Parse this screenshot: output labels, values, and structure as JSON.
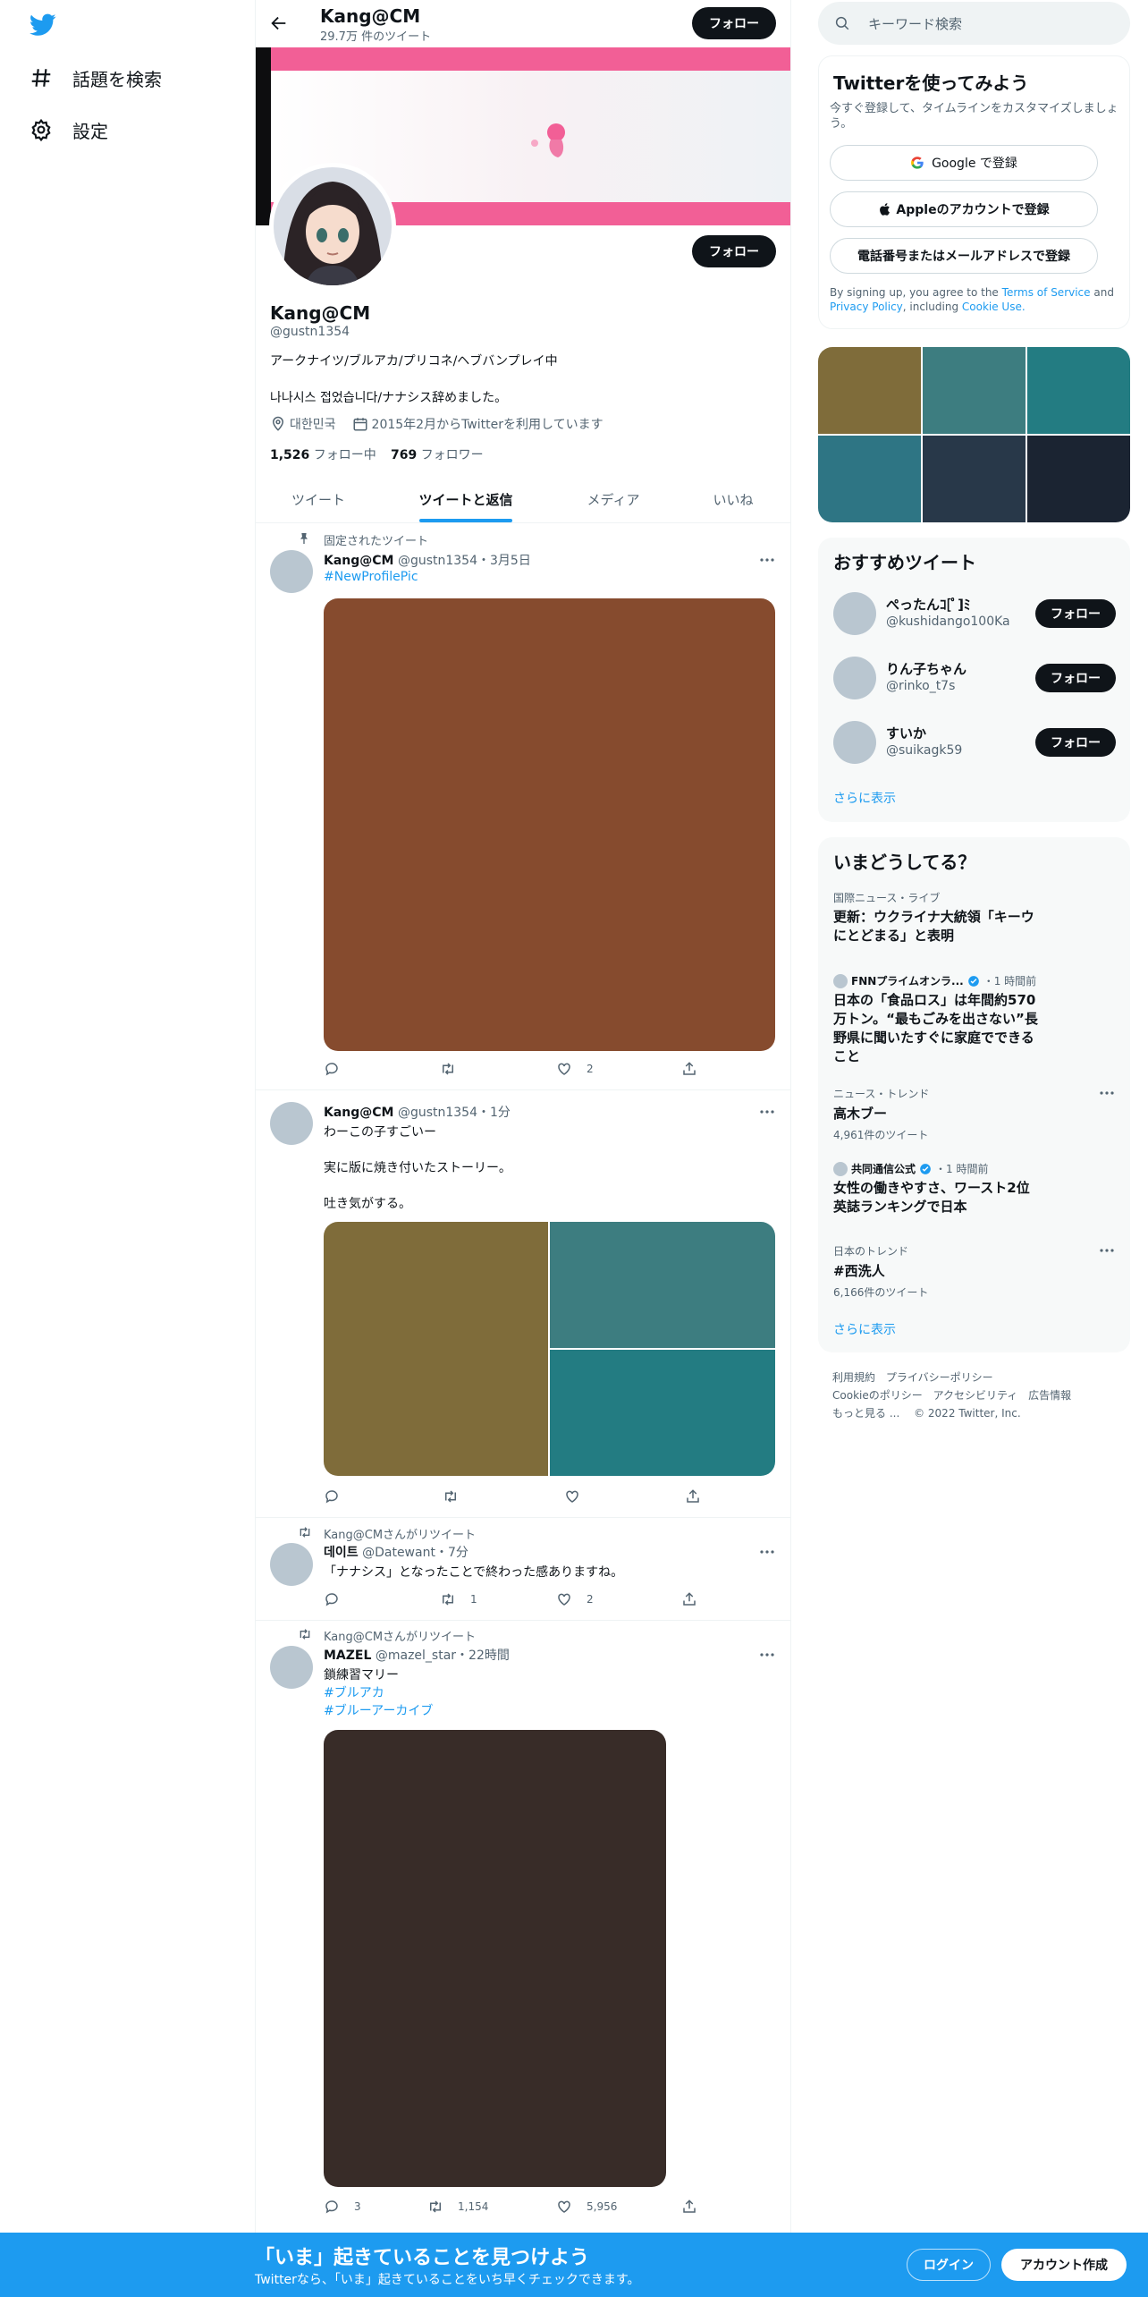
{
  "nav": {
    "explore": "話題を検索",
    "settings": "設定"
  },
  "header": {
    "name": "Kang@CM",
    "tweet_count": "29.7万 件のツイート",
    "follow": "フォロー"
  },
  "profile": {
    "name": "Kang@CM",
    "handle": "@gustn1354",
    "bio1": "アークナイツ/ブルアカ/プリコネ/ヘブバンプレイ中",
    "bio2": "나나시스 접었습니다/ナナシス辞めました。",
    "location": "대한민국",
    "joined": "2015年2月からTwitterを利用しています",
    "following_count": "1,526",
    "following_label": "フォロー中",
    "followers_count": "769",
    "followers_label": "フォロワー",
    "follow": "フォロー"
  },
  "tabs": [
    "ツイート",
    "ツイートと返信",
    "メディア",
    "いいね"
  ],
  "tweets": [
    {
      "pinned": "固定されたツイート",
      "name": "Kang@CM",
      "handle": "@gustn1354",
      "time": "3月5日",
      "hashtag": "#NewProfilePic",
      "likes": "2",
      "media_color": "#864b2e"
    },
    {
      "name": "Kang@CM",
      "handle": "@gustn1354",
      "time": "1分",
      "line1": "わーこの子すごいー",
      "line2": "実に版に焼き付いたストーリー。",
      "line3": "吐き気がする。",
      "colors": [
        "#7f6c3a",
        "#3d7d80",
        "#237c82"
      ]
    },
    {
      "retweeted": "Kang@CMさんがリツイート",
      "name": "데이트",
      "handle": "@Datewant",
      "time": "7分",
      "text": "「ナナシス」となったことで終わった感ありますね。",
      "retweets": "1",
      "likes": "2"
    },
    {
      "retweeted": "Kang@CMさんがリツイート",
      "name": "MAZEL",
      "handle": "@mazel_star",
      "time": "22時間",
      "line1": "鎖練習マリー",
      "tag1": "#ブルアカ",
      "tag2": "#ブルーアーカイブ",
      "replies": "3",
      "retweets": "1,154",
      "likes": "5,956",
      "media_color": "#382c28"
    }
  ],
  "search": {
    "placeholder": "キーワード検索"
  },
  "signup": {
    "title": "Twitterを使ってみよう",
    "subtitle": "今すぐ登録して、タイムラインをカスタマイズしましょう。",
    "google": "Google で登録",
    "apple": "Appleのアカウントで登録",
    "phone": "電話番号またはメールアドレスで登録",
    "terms_prefix": "By signing up, you agree to the",
    "terms": "Terms of Service",
    "and": "and",
    "privacy": "Privacy Policy",
    "including": ", including",
    "cookie": "Cookie Use."
  },
  "media_grid": {
    "colors": [
      "#7f6c3a",
      "#3d7d80",
      "#237c82",
      "#2e7584",
      "#283849",
      "#1b2432"
    ]
  },
  "recommend": {
    "title": "おすすめツイート",
    "users": [
      {
        "name": "ぺったんｺ[ﾟ]ﾐ",
        "handle": "@kushidango100Ka"
      },
      {
        "name": "りん子ちゃん",
        "handle": "@rinko_t7s"
      },
      {
        "name": "すいか",
        "handle": "@suikagk59"
      }
    ],
    "follow": "フォロー",
    "more": "さらに表示"
  },
  "trends": {
    "title": "いまどうしてる？",
    "items": [
      {
        "meta": "国際ニュース・ライブ",
        "text": "更新：ウクライナ大統領「キーウにとどまる」と表明"
      },
      {
        "source": "FNNプライムオンラ...",
        "time": "・1 時間前",
        "text": "日本の「食品ロス」は年間約570万トン。“最もごみを出さない”長野県に聞いたすぐに家庭でできること"
      },
      {
        "meta": "ニュース・トレンド",
        "text": "高木ブー",
        "count": "4,961件のツイート"
      },
      {
        "source": "共同通信公式",
        "time": "・1 時間前",
        "text": "女性の働きやすさ、ワースト2位 英誌ランキングで日本"
      },
      {
        "meta": "日本のトレンド",
        "text": "#西洗人",
        "count": "6,166件のツイート"
      }
    ],
    "more": "さらに表示"
  },
  "footer": {
    "terms": "利用規約",
    "privacy": "プライバシーポリシー",
    "cookie": "Cookieのポリシー",
    "access": "アクセシビリティ",
    "ads": "広告情報",
    "more": "もっと見る ...",
    "copy": "© 2022 Twitter, Inc."
  },
  "bottom": {
    "title": "「いま」起きていることを見つけよう",
    "sub": "Twitterなら、「いま」起きていることをいち早くチェックできます。",
    "login": "ログイン",
    "signup": "アカウント作成"
  },
  "colors": {
    "brand": "#1d9bf0",
    "banner": "#f25f96"
  }
}
